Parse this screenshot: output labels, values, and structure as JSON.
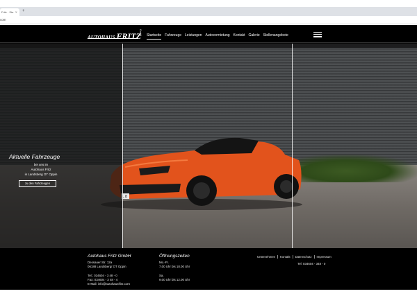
{
  "browser": {
    "tab_title": "Fritz · Sta",
    "tab_close": "×",
    "new_tab": "+",
    "address": "com"
  },
  "site": {
    "logo_prefix": "AUTOHAUS ",
    "logo_main": "FRITZ",
    "logo_suffix": "GmbH",
    "nav": [
      "Startseite",
      "Fahrzeuge",
      "Leistungen",
      "Autovermietung",
      "Kontakt",
      "Galerie",
      "Stellenangebote"
    ],
    "active_nav_index": 0
  },
  "hero": {
    "title": "Aktuelle Fahrzeuge",
    "lines": [
      "bei uns im",
      "Autohaus Fritz",
      "in Landsberg OT Oppin"
    ],
    "button_label": "zu den Fahrzeugen",
    "car_plate": "L 8"
  },
  "footer": {
    "company_heading": "Autohaus Fritz GmbH",
    "address_lines": [
      "Dessauer Str. 12a",
      "06188 Landsberg/ OT Oppin"
    ],
    "tel": "Tel.: 034604 - 3 48 - 0",
    "fax": "Fax: 034604 - 3 48 - 4",
    "email": "E-Mail: info@autohausfritz.com",
    "hours_heading": "Öffnungszeiten",
    "weekday_label": "Mo.-Fr.",
    "weekday_hours": "7.00 Uhr bis 18.00 Uhr",
    "saturday_label": "Sa.",
    "saturday_hours": "9.00 Uhr bis 12.00 Uhr",
    "links": [
      "Unternehmen",
      "Kontakt",
      "Datenschutz",
      "Impressum"
    ],
    "phone_short": "Tel: 034604 - 348 - 0"
  },
  "colors": {
    "car": "#e2531c",
    "nav_bg": "#000000",
    "wall": "#47494b"
  }
}
